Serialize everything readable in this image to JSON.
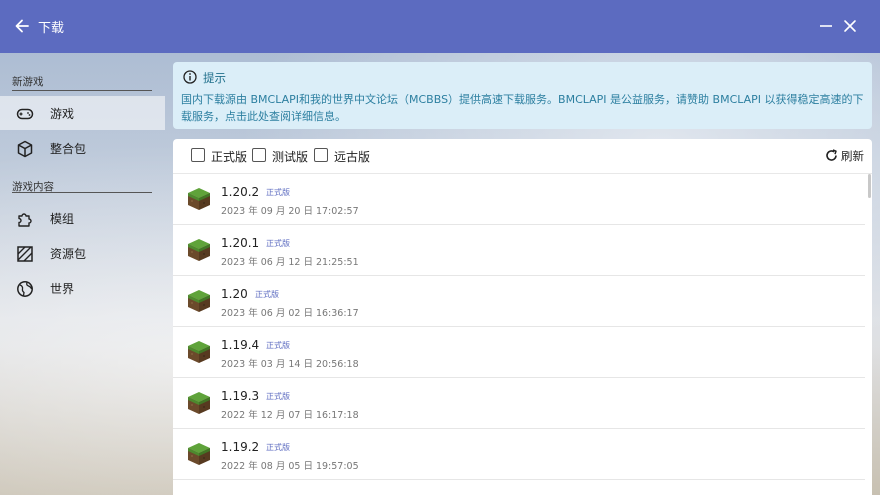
{
  "window": {
    "title": "下载"
  },
  "sidebar": {
    "section_new": "新游戏",
    "section_content": "游戏内容",
    "items": [
      {
        "label": "游戏",
        "icon": "gamepad-icon"
      },
      {
        "label": "整合包",
        "icon": "package-icon"
      },
      {
        "label": "模组",
        "icon": "puzzle-icon"
      },
      {
        "label": "资源包",
        "icon": "texture-icon"
      },
      {
        "label": "世界",
        "icon": "globe-icon"
      }
    ]
  },
  "tip": {
    "title": "提示",
    "body": "国内下载源由 BMCLAPI和我的世界中文论坛（MCBBS）提供高速下载服务。BMCLAPI 是公益服务，请赞助 BMCLAPI 以获得稳定高速的下载服务，点击此处查阅详细信息。"
  },
  "filters": {
    "release": "正式版",
    "snapshot": "测试版",
    "old": "远古版",
    "refresh": "刷新"
  },
  "versions": [
    {
      "version": "1.20.2",
      "tag": "正式版",
      "date": "2023 年 09 月 20 日 17:02:57"
    },
    {
      "version": "1.20.1",
      "tag": "正式版",
      "date": "2023 年 06 月 12 日 21:25:51"
    },
    {
      "version": "1.20",
      "tag": "正式版",
      "date": "2023 年 06 月 02 日 16:36:17"
    },
    {
      "version": "1.19.4",
      "tag": "正式版",
      "date": "2023 年 03 月 14 日 20:56:18"
    },
    {
      "version": "1.19.3",
      "tag": "正式版",
      "date": "2022 年 12 月 07 日 16:17:18"
    },
    {
      "version": "1.19.2",
      "tag": "正式版",
      "date": "2022 年 08 月 05 日 19:57:05"
    }
  ],
  "colors": {
    "accent": "#5c6bc0",
    "tip_bg": "#dbeef8",
    "tip_text": "#1f6f8b"
  }
}
